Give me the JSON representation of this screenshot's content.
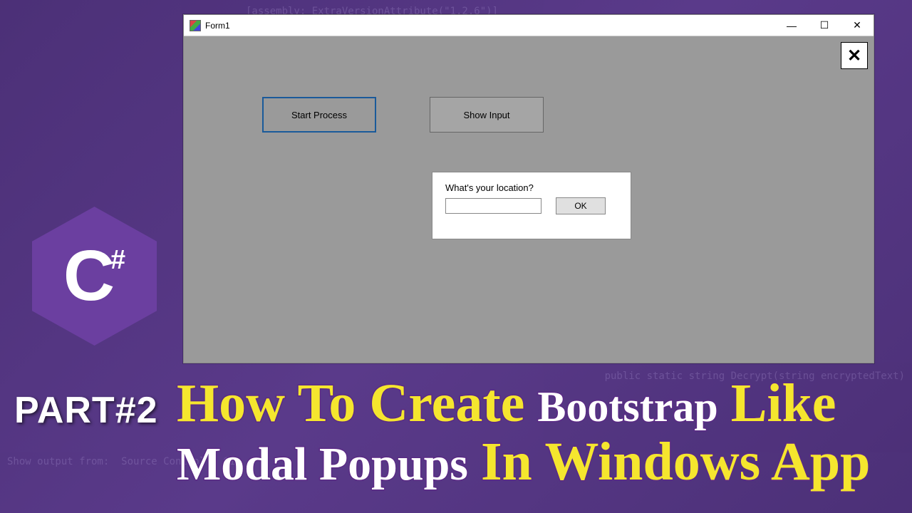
{
  "background": {
    "lines": [
      "[assembly: ExtraVersionAttribute(\"1.2.6\")]",
      "public static string Decrypt(string encryptedText)",
      "Show output from:  Source Control - Git"
    ]
  },
  "window": {
    "title": "Form1",
    "controls": {
      "minimize": "—",
      "maximize": "☐",
      "close": "✕"
    },
    "big_close": "✕",
    "buttons": {
      "start": "Start Process",
      "show": "Show  Input"
    },
    "popup": {
      "label": "What's your location?",
      "input_value": "",
      "ok_label": "OK"
    }
  },
  "logo": {
    "letter": "C",
    "hash": "#"
  },
  "banner": {
    "part_label": "PART#2",
    "line1": {
      "w1": "How To Create",
      "w2": "Bootstrap",
      "w3": "Like"
    },
    "line2": {
      "w1": "Modal Popups",
      "w2": "In Windows App"
    }
  }
}
